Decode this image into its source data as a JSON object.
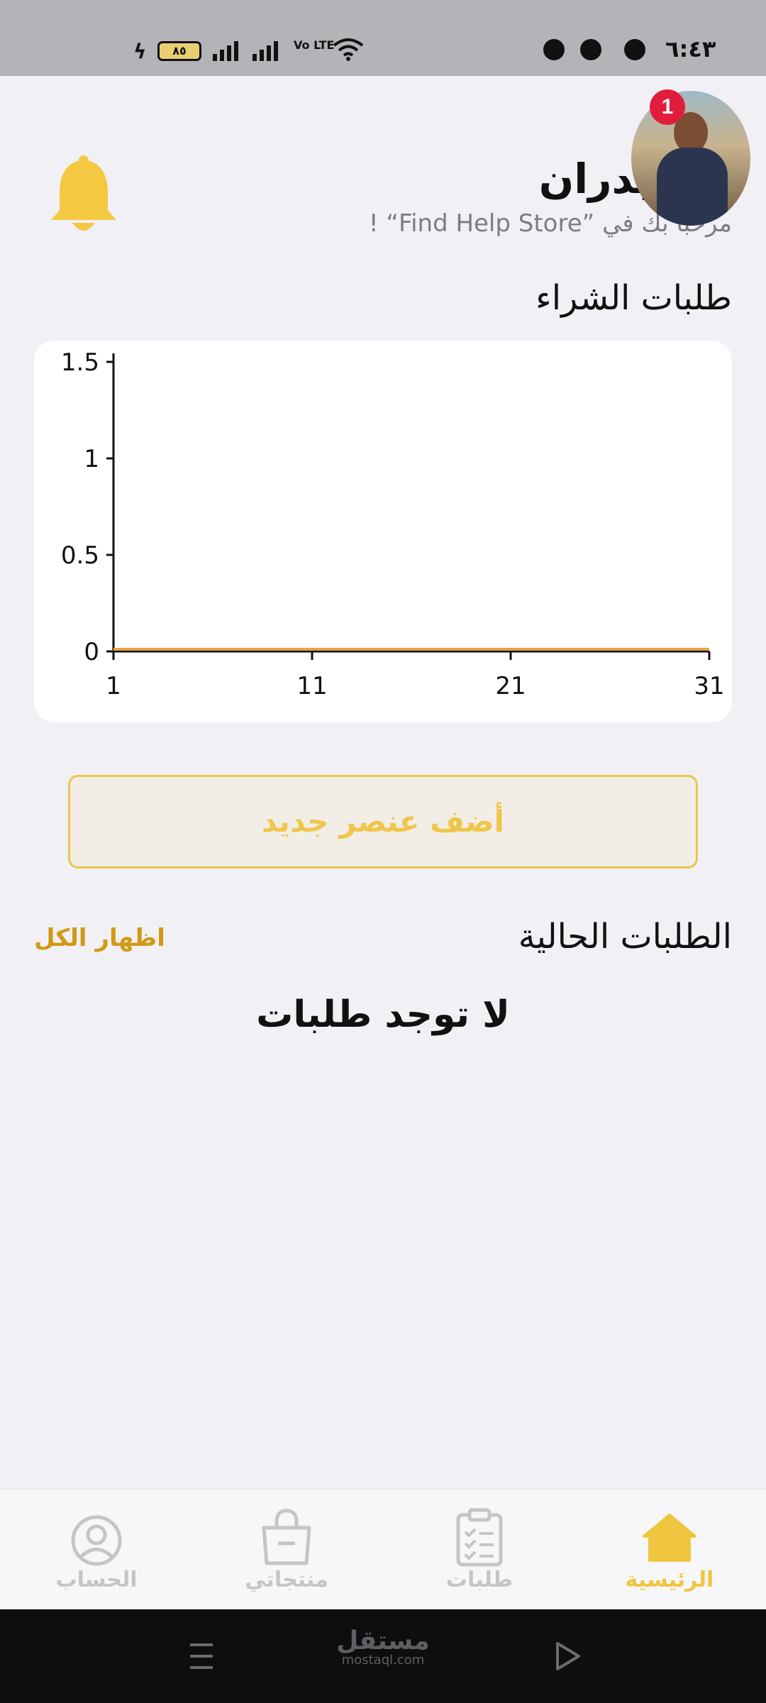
{
  "status_bar": {
    "time": "٦:٤٣",
    "battery": "٨٥",
    "network": "Vo LTE",
    "icons": [
      "messenger-icon",
      "messenger-icon",
      "snapchat-icon",
      "wifi-icon",
      "signal-icon",
      "signal-icon",
      "battery-icon",
      "charging-icon"
    ]
  },
  "header": {
    "greeting": "، بدران",
    "welcome": "مرحبا بك في ”Find Help Store“ !",
    "notification_count": "1",
    "bell_color": "#f5c842",
    "badge_color": "#e01e3c"
  },
  "purchase_section": {
    "title": "طلبات الشراء"
  },
  "chart_data": {
    "type": "line",
    "x": [
      1,
      11,
      21,
      31
    ],
    "xticks": [
      "1",
      "11",
      "21",
      "31"
    ],
    "yticks": [
      "0",
      "0.5",
      "1",
      "1.5"
    ],
    "xlim": [
      1,
      31
    ],
    "ylim": [
      0,
      1.5
    ],
    "series": [
      {
        "values": [
          0,
          0,
          0,
          0
        ],
        "color": "#e9a23b"
      }
    ],
    "grid": false
  },
  "add_button": {
    "label": "أضف عنصر جديد"
  },
  "current_orders": {
    "title": "الطلبات الحالية",
    "show_all": "اظهار الكل",
    "empty": "لا توجد طلبات"
  },
  "bottom_nav": {
    "items": [
      {
        "label": "الرئيسية",
        "icon": "home-icon",
        "active": true
      },
      {
        "label": "طلبات",
        "icon": "clipboard-icon",
        "active": false
      },
      {
        "label": "منتجاتي",
        "icon": "shopping-bag-icon",
        "active": false
      },
      {
        "label": "الحساب",
        "icon": "account-icon",
        "active": false
      }
    ],
    "active_color": "#f0c53f",
    "inactive_color": "#c5c5c8"
  },
  "system_nav": {
    "watermark": "مستقل",
    "watermark_sub": "mostaql.com"
  }
}
